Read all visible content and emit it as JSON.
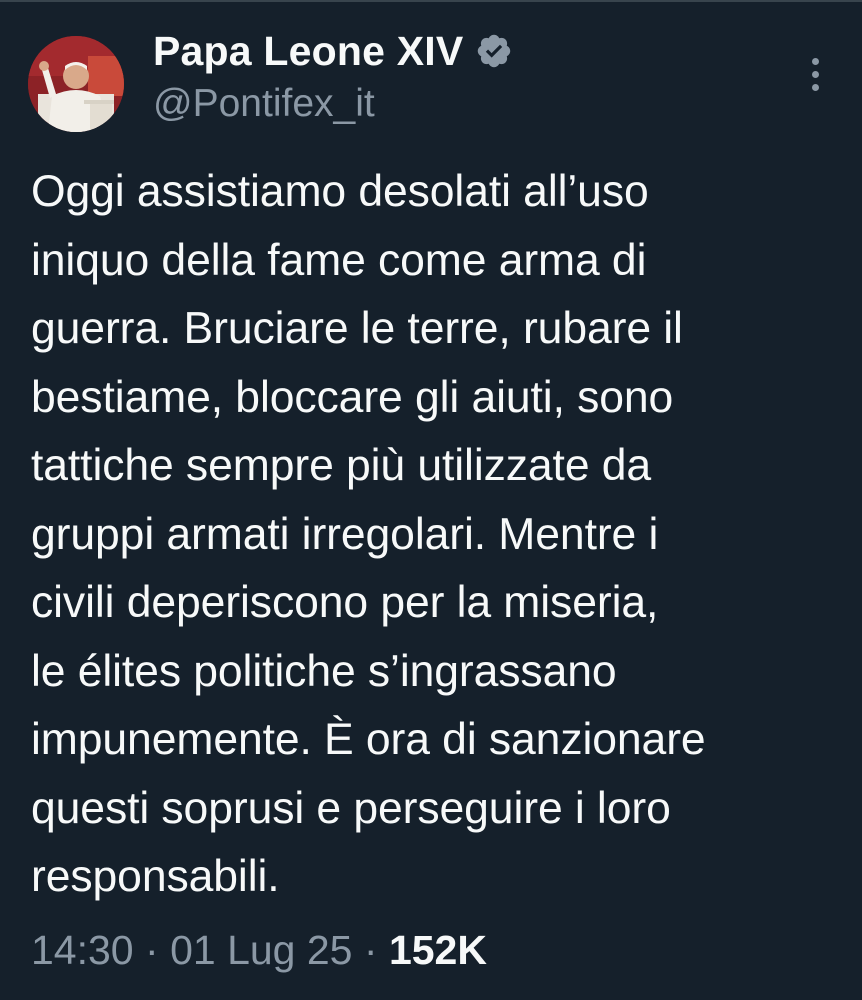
{
  "author": {
    "display_name": "Papa Leone XIV",
    "handle": "@Pontifex_it",
    "verified": true
  },
  "tweet": {
    "text": "Oggi assistiamo desolati all’uso\niniquo della fame come arma di\nguerra. Bruciare le terre, rubare il\nbestiame, bloccare gli aiuti, sono\ntattiche sempre più utilizzate da\ngruppi armati irregolari. Mentre i\ncivili deperiscono per la miseria,\nle élites politiche s’ingrassano\nimpunemente. È ora di sanzionare\nquesti soprusi e perseguire i loro\nresponsabili.",
    "time": "14:30",
    "separator": "·",
    "date": "01 Lug 25",
    "views": "152K"
  },
  "icons": {
    "verified": "verified-badge-icon",
    "more": "more-options-icon",
    "avatar": "profile-photo"
  },
  "colors": {
    "background": "#15202b",
    "primary_text": "#f7f9f9",
    "secondary_text": "#8b98a5"
  }
}
